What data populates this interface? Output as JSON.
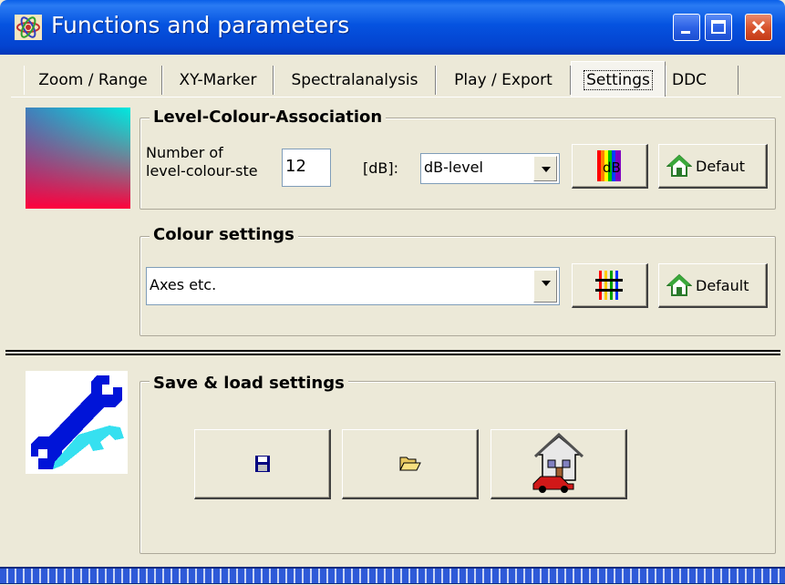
{
  "window": {
    "title": "Functions and parameters",
    "icon": "app-atom-icon"
  },
  "tabs": [
    {
      "label": "Zoom / Range"
    },
    {
      "label": "XY-Marker"
    },
    {
      "label": "Spectralanalysis"
    },
    {
      "label": "Play / Export"
    },
    {
      "label": "Settings",
      "active": true
    },
    {
      "label": "DDC"
    }
  ],
  "level_colour": {
    "title": "Level-Colour-Association",
    "steps_label_line1": "Number of",
    "steps_label_line2": "level-colour-ste",
    "steps_value": "12",
    "db_label": "[dB]:",
    "db_select_value": "dB-level",
    "palette_button_icon": "db-rainbow-icon",
    "default_label": "Defaut"
  },
  "colour_settings": {
    "title": "Colour settings",
    "select_value": "Axes etc.",
    "palette_button_icon": "color-grid-icon",
    "default_label": "Default"
  },
  "save_load": {
    "title": "Save & load settings",
    "save_icon": "floppy-disk-icon",
    "open_icon": "folder-open-icon",
    "home_icon": "house-car-icon"
  }
}
